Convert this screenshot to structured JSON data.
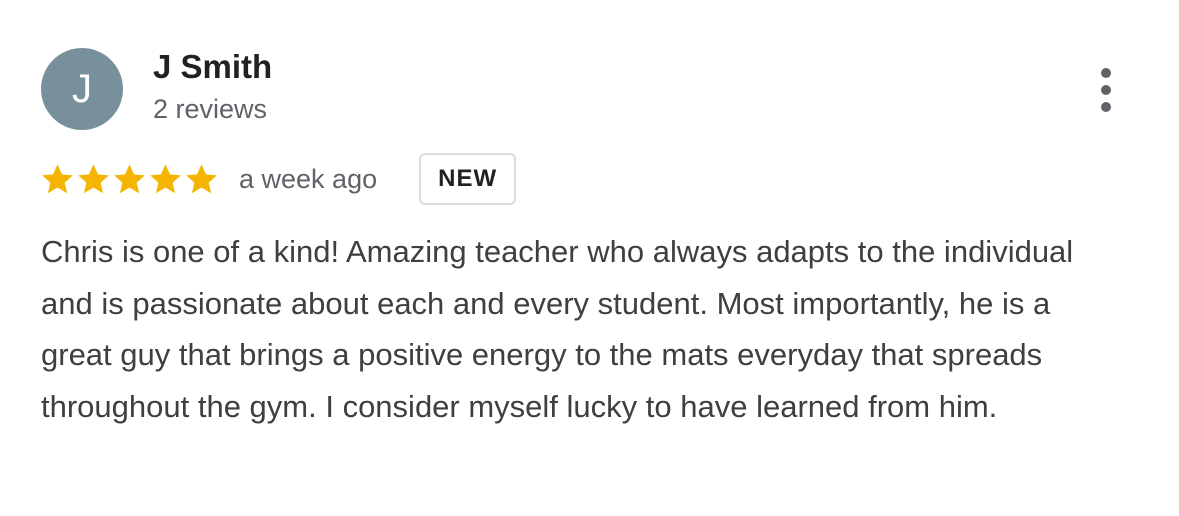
{
  "review": {
    "author": {
      "initial": "J",
      "name": "J Smith",
      "review_count": "2 reviews",
      "avatar_color": "#78909c"
    },
    "rating": {
      "value": 5,
      "max": 5,
      "star_color": "#f4b400"
    },
    "timestamp": "a week ago",
    "badge": "NEW",
    "text": "Chris is one of a kind! Amazing teacher who always adapts to the individual and is passionate about each and every student. Most importantly, he is a great guy that brings a positive energy to the mats everyday that spreads throughout the gym. I consider myself lucky to have learned from him.",
    "menu_icon": "more-vert-icon"
  }
}
